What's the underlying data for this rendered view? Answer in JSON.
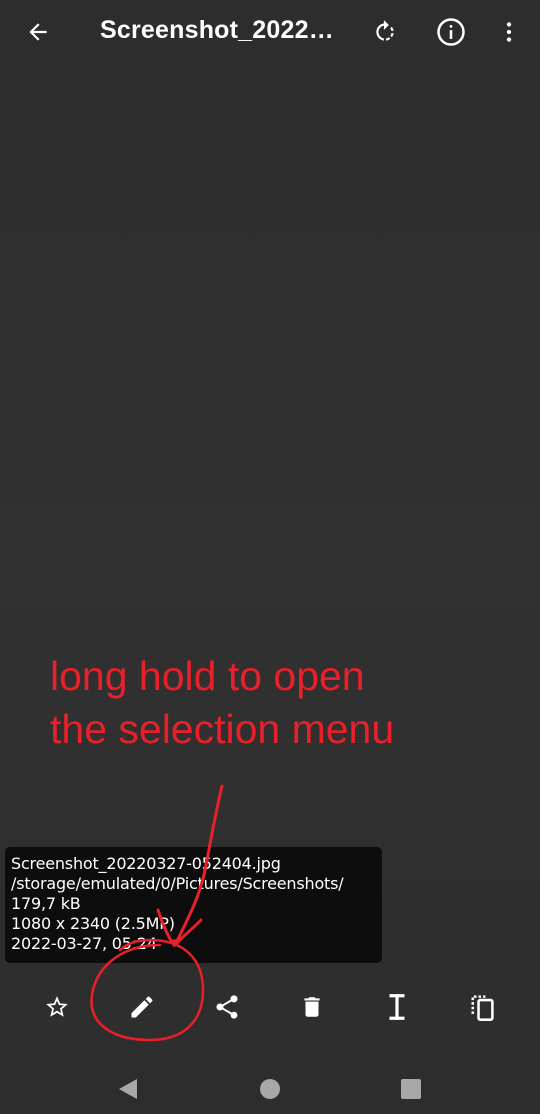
{
  "header": {
    "title": "Screenshot_20220327-052404.jpg",
    "icons": [
      "back-arrow-icon",
      "rotate-icon",
      "info-icon",
      "more-vert-icon"
    ]
  },
  "annotation": {
    "line1": "long hold to open",
    "line2": "the selection menu",
    "color": "#e8202a"
  },
  "file_info": {
    "name": "Screenshot_20220327-052404.jpg",
    "path": "/storage/emulated/0/Pictures/Screenshots/",
    "size": "179,7 kB",
    "resolution": "1080 x 2340 (2.5MP)",
    "date": "2022-03-27, 05:24"
  },
  "actions": [
    "star-icon",
    "edit-icon",
    "share-icon",
    "delete-icon",
    "text-cursor-icon",
    "copy-icon"
  ],
  "navigation": [
    "back-triangle-icon",
    "home-circle-icon",
    "recents-square-icon"
  ],
  "colors": {
    "background": "#2b2b2b",
    "foreground": "#ffffff",
    "annotation_red": "#e8202a",
    "nav_icon": "#a8a8a8"
  }
}
